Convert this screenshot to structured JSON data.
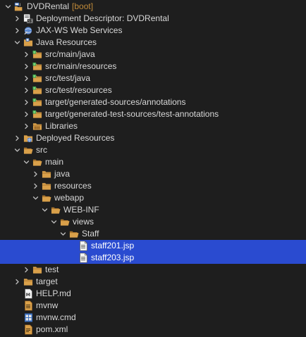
{
  "project_explorer": {
    "rows": [
      {
        "label": "DVDRental",
        "decoration": "[boot]",
        "icon": "project-icon",
        "depth": 0,
        "expanded": true
      },
      {
        "label": "Deployment Descriptor: DVDRental",
        "icon": "deployment-descriptor-icon",
        "depth": 1,
        "expanded": false
      },
      {
        "label": "JAX-WS Web Services",
        "icon": "web-services-icon",
        "depth": 1,
        "expanded": false
      },
      {
        "label": "Java Resources",
        "icon": "java-resources-icon",
        "depth": 1,
        "expanded": true
      },
      {
        "label": "src/main/java",
        "icon": "source-folder-icon",
        "depth": 2,
        "expanded": false
      },
      {
        "label": "src/main/resources",
        "icon": "source-folder-icon",
        "depth": 2,
        "expanded": false
      },
      {
        "label": "src/test/java",
        "icon": "source-folder-icon",
        "depth": 2,
        "expanded": false
      },
      {
        "label": "src/test/resources",
        "icon": "source-folder-icon",
        "depth": 2,
        "expanded": false
      },
      {
        "label": "target/generated-sources/annotations",
        "icon": "source-folder-icon",
        "depth": 2,
        "expanded": false
      },
      {
        "label": "target/generated-test-sources/test-annotations",
        "icon": "source-folder-icon",
        "depth": 2,
        "expanded": false
      },
      {
        "label": "Libraries",
        "icon": "libraries-icon",
        "depth": 2,
        "expanded": false
      },
      {
        "label": "Deployed Resources",
        "icon": "deployed-resources-icon",
        "depth": 1,
        "expanded": false
      },
      {
        "label": "src",
        "icon": "folder-icon",
        "depth": 1,
        "expanded": true
      },
      {
        "label": "main",
        "icon": "folder-icon",
        "depth": 2,
        "expanded": true
      },
      {
        "label": "java",
        "icon": "folder-icon",
        "depth": 3,
        "expanded": false
      },
      {
        "label": "resources",
        "icon": "folder-icon",
        "depth": 3,
        "expanded": false
      },
      {
        "label": "webapp",
        "icon": "folder-icon",
        "depth": 3,
        "expanded": true
      },
      {
        "label": "WEB-INF",
        "icon": "folder-icon",
        "depth": 4,
        "expanded": true
      },
      {
        "label": "views",
        "icon": "folder-icon",
        "depth": 5,
        "expanded": true
      },
      {
        "label": "Staff",
        "icon": "folder-icon",
        "depth": 6,
        "expanded": true
      },
      {
        "label": "staff201.jsp",
        "icon": "jsp-file-icon",
        "depth": 7,
        "selected": true
      },
      {
        "label": "staff203.jsp",
        "icon": "jsp-file-icon",
        "depth": 7,
        "selected": true
      },
      {
        "label": "test",
        "icon": "folder-icon",
        "depth": 2,
        "expanded": false
      },
      {
        "label": "target",
        "icon": "folder-icon",
        "depth": 1,
        "expanded": false
      },
      {
        "label": "HELP.md",
        "icon": "markdown-file-icon",
        "depth": 1
      },
      {
        "label": "mvnw",
        "icon": "text-file-icon",
        "depth": 1
      },
      {
        "label": "mvnw.cmd",
        "icon": "cmd-file-icon",
        "depth": 1
      },
      {
        "label": "pom.xml",
        "icon": "xml-file-icon",
        "depth": 1
      }
    ]
  },
  "colors": {
    "background": "#1e1e1e",
    "selection": "#2a4bd0",
    "text": "#d8d8d8",
    "decoration": "#c08a3a",
    "folder": "#d9a04a"
  }
}
